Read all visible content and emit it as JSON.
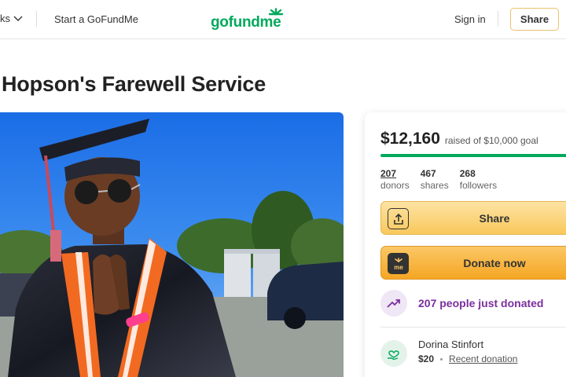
{
  "header": {
    "nav_left_label": "ks",
    "start_label": "Start a GoFundMe",
    "logo_text": "gofundme",
    "signin_label": "Sign in",
    "share_label": "Share"
  },
  "campaign": {
    "title": "Hopson's Farewell Service"
  },
  "donation": {
    "raised": "$12,160",
    "goal_text": "raised of $10,000 goal",
    "progress_fraction": 1.0,
    "stats": [
      {
        "value": "207",
        "label": "donors"
      },
      {
        "value": "467",
        "label": "shares"
      },
      {
        "value": "268",
        "label": "followers"
      }
    ],
    "share_button": "Share",
    "donate_button": "Donate now",
    "activity_text": "207 people just donated",
    "recent_donor": {
      "name": "Dorina Stinfort",
      "amount": "$20",
      "tag": "Recent donation"
    }
  },
  "colors": {
    "brand_green": "#02a95c",
    "donate_orange": "#f5a623",
    "share_yellow": "#f9c85b",
    "activity_purple": "#7a2e9c"
  },
  "icons": [
    "chevron-down-icon",
    "gofundme-sun-icon",
    "share-upload-icon",
    "donate-me-icon",
    "trending-up-icon",
    "donor-heart-hand-icon"
  ]
}
